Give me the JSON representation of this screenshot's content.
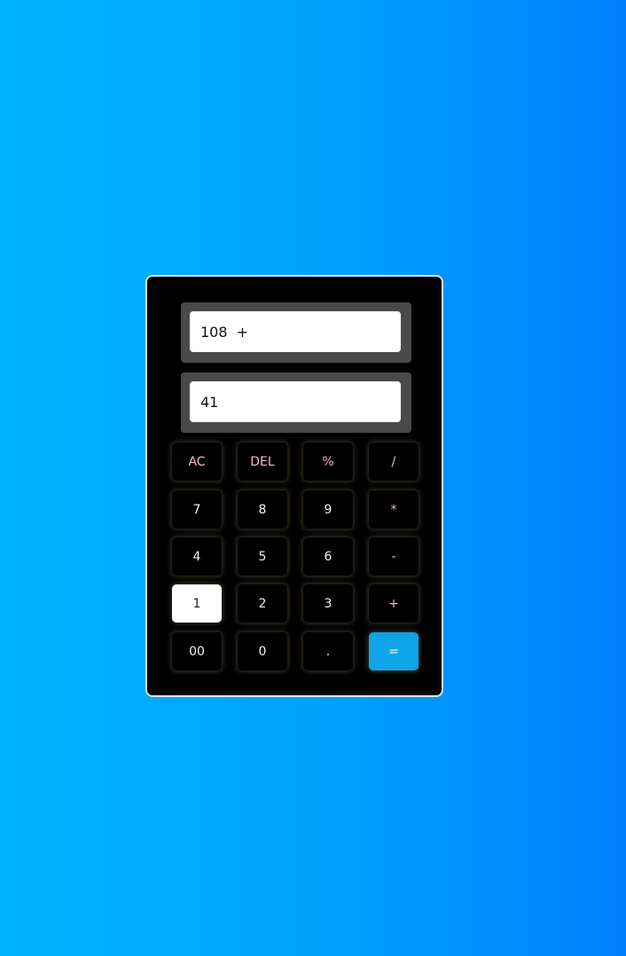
{
  "display": {
    "previous": "108  +",
    "current": "41"
  },
  "keys": {
    "ac": "AC",
    "del": "DEL",
    "percent": "%",
    "divide": "/",
    "seven": "7",
    "eight": "8",
    "nine": "9",
    "multiply": "*",
    "four": "4",
    "five": "5",
    "six": "6",
    "minus": "-",
    "one": "1",
    "two": "2",
    "three": "3",
    "plus": "+",
    "double_zero": "00",
    "zero": "0",
    "dot": ".",
    "equals": "="
  },
  "colors": {
    "background_left": "#00b2fd",
    "background_right": "#0080ff",
    "calculator_body": "#000000",
    "display_frame": "#4a4a4a",
    "operator_text": "#f7b8c6",
    "equals_key": "#0ea5e9",
    "hovered_key": "#ffffff"
  }
}
